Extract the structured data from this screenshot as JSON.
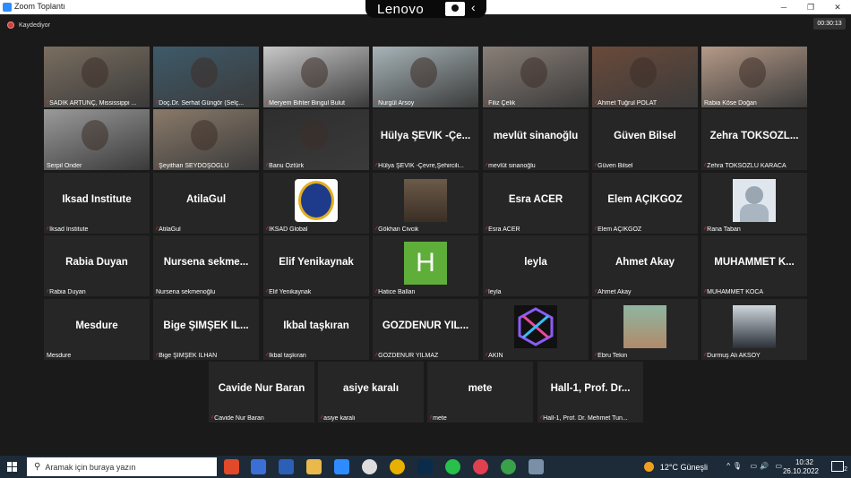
{
  "window": {
    "title": "Zoom Toplantı"
  },
  "device_bar": {
    "brand": "Lenovo"
  },
  "recording": {
    "label": "Kaydediyor"
  },
  "timer": "00:30:13",
  "tiles": [
    {
      "label": "SADIK ARTUNÇ, Mississippi ...",
      "display": "",
      "video": "#7a6e60",
      "muted": true
    },
    {
      "label": "Doç.Dr. Serhat Güngör (Selç...",
      "display": "",
      "video": "#3e5a6a",
      "muted": true
    },
    {
      "label": "Meryem Bihter Bingul Bulut",
      "display": "",
      "video": "#c8c8c8",
      "muted": true
    },
    {
      "label": "Nurgül Arsoy",
      "display": "",
      "video": "#a7b4b8",
      "muted": true
    },
    {
      "label": "Filiz Çelik",
      "display": "",
      "video": "#8a7f78",
      "muted": true
    },
    {
      "label": "Ahmet Tuğrul POLAT",
      "display": "",
      "video": "#6a4a3a",
      "muted": true
    },
    {
      "label": "Rabia Köse Doğan",
      "display": "",
      "video": "#b59a88",
      "muted": false,
      "active": true
    },
    {
      "label": "Serpil Önder",
      "display": "",
      "video": "#9a9a9a",
      "muted": false
    },
    {
      "label": "Şeyithan SEYDOŞOĞLU",
      "display": "",
      "video": "#8a7a6a",
      "muted": true
    },
    {
      "label": "Banu Öztürk",
      "display": "",
      "video": "#2e2e2e",
      "muted": true
    },
    {
      "label": "Hülya ŞEVİK -Çevre,Şehircili...",
      "display": "Hülya ŞEVİK -Çe...",
      "muted": true
    },
    {
      "label": "mevlüt sinanoğlu",
      "display": "mevlüt sinanoğlu",
      "muted": true
    },
    {
      "label": "Güven Bilsel",
      "display": "Güven Bilsel",
      "muted": true
    },
    {
      "label": "Zehra TOKSÖZLÜ KARACA",
      "display": "Zehra TOKSÖZL...",
      "muted": true
    },
    {
      "label": "Iksad Institute",
      "display": "Iksad Institute",
      "muted": true
    },
    {
      "label": "AtilaGul",
      "display": "AtilaGul",
      "muted": true
    },
    {
      "label": "IKSAD Global",
      "display": "",
      "thumb": "logo",
      "muted": true
    },
    {
      "label": "Gökhan Civcik",
      "display": "",
      "thumb": "photo",
      "muted": true
    },
    {
      "label": "Esra ACER",
      "display": "Esra ACER",
      "muted": true
    },
    {
      "label": "Elem AÇIKGÖZ",
      "display": "Elem AÇIKGÖZ",
      "muted": true
    },
    {
      "label": "Rana Taban",
      "display": "",
      "thumb": "superman",
      "muted": true
    },
    {
      "label": "Rabia Duyan",
      "display": "Rabia Duyan",
      "muted": true
    },
    {
      "label": "Nursena sekmenoğlu",
      "display": "Nursena sekme...",
      "muted": false
    },
    {
      "label": "Elif Yenikaynak",
      "display": "Elif Yenikaynak",
      "muted": true
    },
    {
      "label": "Hatice Ballan",
      "display": "",
      "thumb": "letter",
      "letter": "H",
      "muted": true
    },
    {
      "label": "leyla",
      "display": "leyla",
      "muted": true
    },
    {
      "label": "Ahmet Akay",
      "display": "Ahmet Akay",
      "muted": true
    },
    {
      "label": "MUHAMMET KOCA",
      "display": "MUHAMMET K...",
      "muted": true
    },
    {
      "label": "Mesdure",
      "display": "Mesdure",
      "muted": false
    },
    {
      "label": "Bige ŞİMŞEK İLHAN",
      "display": "Bige ŞİMŞEK İL...",
      "muted": true
    },
    {
      "label": "İkbal taşkıran",
      "display": "İkbal taşkıran",
      "muted": true
    },
    {
      "label": "GÖZDENUR YILMAZ",
      "display": "GÖZDENUR YIL...",
      "muted": true
    },
    {
      "label": "AKIN",
      "display": "",
      "thumb": "hex",
      "muted": true
    },
    {
      "label": "Ebru Tekin",
      "display": "",
      "thumb": "woman",
      "muted": true
    },
    {
      "label": "Durmuş Ali AKSOY",
      "display": "",
      "thumb": "man",
      "muted": true
    },
    {
      "label": "Cavide Nur Baran",
      "display": "Cavide Nur Baran",
      "muted": true
    },
    {
      "label": "asiye karalı",
      "display": "asiye karalı",
      "muted": true
    },
    {
      "label": "mete",
      "display": "mete",
      "muted": true
    },
    {
      "label": "Hall-1, Prof. Dr. Mehmet Tun...",
      "display": "Hall-1, Prof. Dr...",
      "muted": true
    }
  ],
  "taskbar": {
    "search_placeholder": "Aramak için buraya yazın",
    "weather": "12°C Güneşli",
    "time": "10:32",
    "date": "26.10.2022",
    "notifications": "2"
  },
  "colors": {
    "active_border": "#d7e23d",
    "muted_icon": "#e03131",
    "tile_bg": "#262626",
    "taskbar_bg": "#1d2a38"
  }
}
